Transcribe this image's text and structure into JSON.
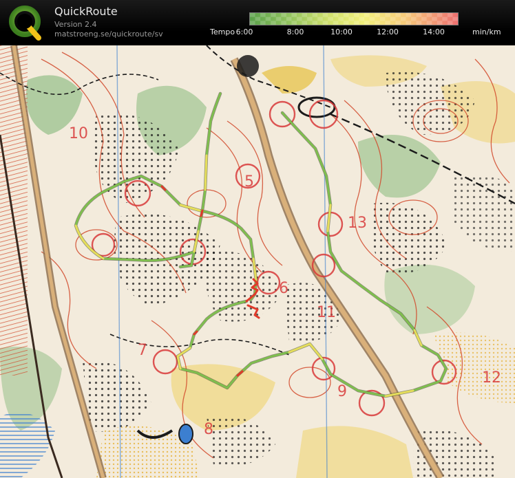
{
  "app": {
    "name": "QuickRoute",
    "version": "Version 2.4",
    "url": "matstroeng.se/quickroute/sv",
    "logo_letter": "Q"
  },
  "legend": {
    "label": "Tempo",
    "unit": "min/km",
    "ticks": [
      "6:00",
      "8:00",
      "10:00",
      "12:00",
      "14:00"
    ],
    "tick_values_min_per_km": [
      6,
      8,
      10,
      12,
      14
    ],
    "range_min_per_km": [
      6,
      15
    ],
    "colors": {
      "fast": "#5aa14a",
      "mid": "#f2f07c",
      "slow": "#ee6f6f"
    }
  },
  "map": {
    "kind": "orienteering map with GPS route overlay",
    "colors": {
      "paper": "#f3ebdc",
      "contour": "#d24a2c",
      "rock": "#1b1b1b",
      "vegetation_green": "#9cc28a",
      "open_yellow": "#e8c85a",
      "course_magenta": "#d83a3a",
      "water": "#3c7fd0",
      "route_fast": "#7fbf4e",
      "route_mid": "#e6dd5c",
      "route_slow": "#e03a2a"
    },
    "control_numbers": [
      "5",
      "6",
      "7",
      "8",
      "9",
      "10",
      "11",
      "12",
      "13"
    ]
  }
}
